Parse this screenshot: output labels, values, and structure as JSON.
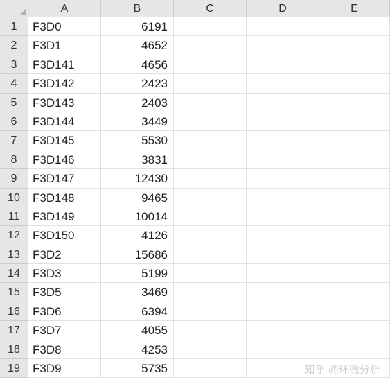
{
  "columns": [
    "A",
    "B",
    "C",
    "D",
    "E"
  ],
  "row_numbers": [
    1,
    2,
    3,
    4,
    5,
    6,
    7,
    8,
    9,
    10,
    11,
    12,
    13,
    14,
    15,
    16,
    17,
    18,
    19
  ],
  "cells": {
    "a": [
      "F3D0",
      "F3D1",
      "F3D141",
      "F3D142",
      "F3D143",
      "F3D144",
      "F3D145",
      "F3D146",
      "F3D147",
      "F3D148",
      "F3D149",
      "F3D150",
      "F3D2",
      "F3D3",
      "F3D5",
      "F3D6",
      "F3D7",
      "F3D8",
      "F3D9"
    ],
    "b": [
      6191,
      4652,
      4656,
      2423,
      2403,
      3449,
      5530,
      3831,
      12430,
      9465,
      10014,
      4126,
      15686,
      5199,
      3469,
      6394,
      4055,
      4253,
      5735
    ]
  },
  "watermark": "知乎 @环微分析",
  "chart_data": {
    "type": "table",
    "title": "",
    "columns": [
      "A",
      "B"
    ],
    "rows": [
      [
        "F3D0",
        6191
      ],
      [
        "F3D1",
        4652
      ],
      [
        "F3D141",
        4656
      ],
      [
        "F3D142",
        2423
      ],
      [
        "F3D143",
        2403
      ],
      [
        "F3D144",
        3449
      ],
      [
        "F3D145",
        5530
      ],
      [
        "F3D146",
        3831
      ],
      [
        "F3D147",
        12430
      ],
      [
        "F3D148",
        9465
      ],
      [
        "F3D149",
        10014
      ],
      [
        "F3D150",
        4126
      ],
      [
        "F3D2",
        15686
      ],
      [
        "F3D3",
        5199
      ],
      [
        "F3D5",
        3469
      ],
      [
        "F3D6",
        6394
      ],
      [
        "F3D7",
        4055
      ],
      [
        "F3D8",
        4253
      ],
      [
        "F3D9",
        5735
      ]
    ]
  }
}
